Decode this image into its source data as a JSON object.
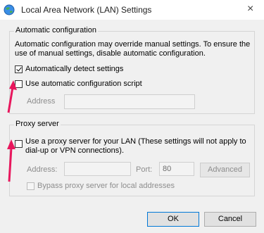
{
  "window": {
    "title": "Local Area Network (LAN) Settings",
    "close_glyph": "×",
    "icon": "globe-network-icon"
  },
  "auto_config": {
    "legend": "Automatic configuration",
    "description_line1": "Automatic configuration may override manual settings.  To ensure the",
    "description_line2": "use of manual settings, disable automatic configuration.",
    "auto_detect": {
      "label": "Automatically detect settings",
      "checked": true
    },
    "use_script": {
      "label": "Use automatic configuration script",
      "checked": false
    },
    "address_label": "Address",
    "address_value": ""
  },
  "proxy": {
    "legend": "Proxy server",
    "use_proxy": {
      "label_line1": "Use a proxy server for your LAN (These settings will not apply to",
      "label_line2": "dial-up or VPN connections).",
      "checked": false
    },
    "address_label": "Address:",
    "address_value": "",
    "port_label": "Port:",
    "port_value": "80",
    "advanced_label": "Advanced",
    "bypass": {
      "label": "Bypass proxy server for local addresses",
      "checked": false
    }
  },
  "buttons": {
    "ok": "OK",
    "cancel": "Cancel"
  },
  "colors": {
    "arrow": "#e8175d",
    "focus_border": "#0078d7"
  }
}
